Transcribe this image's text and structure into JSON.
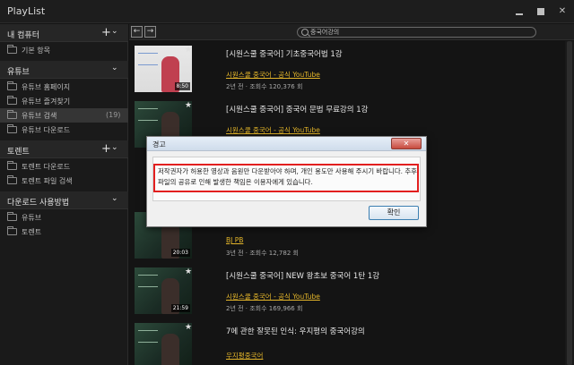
{
  "app": {
    "title": "PlayList"
  },
  "window_controls": {
    "close": "✕"
  },
  "sidebar": {
    "sections": [
      {
        "label": "내 컴퓨터",
        "plus": "+",
        "chevron": "⌄",
        "items": [
          {
            "label": "기본 항목"
          }
        ]
      },
      {
        "label": "유튜브",
        "chevron": "⌄",
        "items": [
          {
            "label": "유튜브 홈페이지"
          },
          {
            "label": "유튜브 즐겨찾기"
          },
          {
            "label": "유튜브 검색",
            "count": "(19)",
            "active": true
          },
          {
            "label": "유튜브 다운로드"
          }
        ]
      },
      {
        "label": "토렌트",
        "plus": "+",
        "chevron": "⌄",
        "items": [
          {
            "label": "토렌트 다운로드"
          },
          {
            "label": "토렌트 파일 검색"
          }
        ]
      },
      {
        "label": "다운로드 사용방법",
        "chevron": "⌄",
        "items": [
          {
            "label": "유튜브"
          },
          {
            "label": "토렌트"
          }
        ]
      }
    ]
  },
  "toolbar": {
    "back": "←",
    "forward": "→",
    "search_value": "중국어강의"
  },
  "videos": [
    {
      "title": "[시원스쿨 중국어] 기초중국어법 1강",
      "channel": "시원스쿨 중국어 - 공식 YouTube",
      "meta": "2년 전 · 조회수 120,376 회",
      "duration": "8:50",
      "star": "★"
    },
    {
      "title": "[시원스쿨 중국어] 중국어 문법 무료강의 1강",
      "channel": "시원스쿨 중국어 - 공식 YouTube",
      "meta": "",
      "duration": "",
      "star": "★"
    },
    {
      "title": "",
      "channel": "BJ PB",
      "meta": "3년 전 · 조회수 12,782 회",
      "duration": "20:03",
      "star": "★"
    },
    {
      "title": "[시원스쿨 중국어] NEW 왕초보 중국어 1탄 1강",
      "channel": "시원스쿨 중국어 - 공식 YouTube",
      "meta": "2년 전 · 조회수 169,966 회",
      "duration": "21:59",
      "star": "★"
    },
    {
      "title": "7에 관한 잘못된 인식: 우지평의 중국어강의",
      "channel": "우지평중국어",
      "meta": "",
      "duration": "",
      "star": "★"
    }
  ],
  "dialog": {
    "title": "경고",
    "message": "저작권자가 허용한 영상과 음원만 다운받아야 하며, 개인 용도만 사용해 주시기 바랍니다. 추후 파일의 공유로 인해 발생한 책임은 이용자에게 있습니다.",
    "ok_label": "확인",
    "close_label": "✕"
  },
  "colors": {
    "channel_link": "#e3b52a",
    "highlight_border": "#e21f1f",
    "dialog_close": "#c74a3e"
  }
}
